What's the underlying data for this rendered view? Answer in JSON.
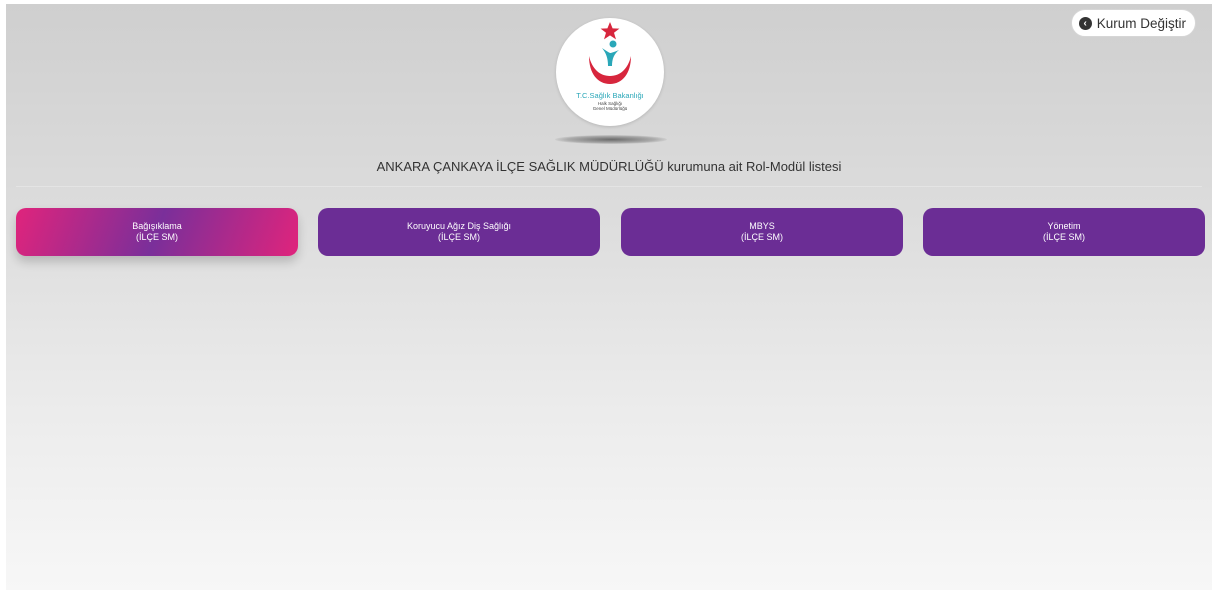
{
  "header": {
    "change_button_label": "Kurum Değiştir",
    "change_icon": "circle-arrow-left-icon",
    "heading": "ANKARA ÇANKAYA İLÇE SAĞLIK MÜDÜRLÜĞÜ kurumuna ait Rol-Modül listesi"
  },
  "logo": {
    "line1": "T.C.Sağlık Bakanlığı",
    "line2": "Halk Sağlığı",
    "line3": "Genel Müdürlüğü",
    "colors": {
      "star": "#d7263d",
      "crescent": "#d7263d",
      "figure": "#2aa7b8"
    }
  },
  "modules": [
    {
      "name": "Bağışıklama",
      "role": "(İLÇE SM)",
      "active": true
    },
    {
      "name": "Koruyucu Ağız Diş Sağlığı",
      "role": "(İLÇE SM)",
      "active": false
    },
    {
      "name": "MBYS",
      "role": "(İLÇE SM)",
      "active": false
    },
    {
      "name": "Yönetim",
      "role": "(İLÇE SM)",
      "active": false
    }
  ],
  "colors": {
    "module_bg": "#6b2d95",
    "module_active_start": "#e0247c",
    "module_active_mid": "#7a2f9a"
  }
}
